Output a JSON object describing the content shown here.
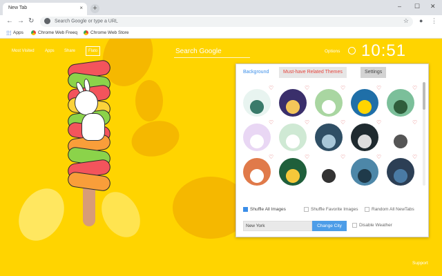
{
  "browser": {
    "tab_title": "New Tab",
    "tab_close": "×",
    "new_tab": "+",
    "window_controls": [
      "–",
      "☐",
      "✕"
    ],
    "omnibox_placeholder": "Search Google or type a URL",
    "bookmarks": [
      "Apps",
      "Chrome Web Freeq",
      "Chrome Web Store"
    ]
  },
  "topnav": {
    "items": [
      "Most Visited",
      "Apps",
      "Share",
      "Flato"
    ]
  },
  "search": {
    "placeholder": "Search Google"
  },
  "header": {
    "options": "Options",
    "time": "10:51"
  },
  "footer": {
    "support": "Support"
  },
  "panel": {
    "tabs": [
      "Background",
      "Must-have Related Themes",
      "Settings"
    ],
    "active_tab": "Background",
    "thumbnails": [
      {
        "bg": "#e8f4f0",
        "fg": "#3a7a6a"
      },
      {
        "bg": "#3a2f6b",
        "fg": "#f3c65a"
      },
      {
        "bg": "#a9d6a1",
        "fg": "#ffffff"
      },
      {
        "bg": "#1f6fa8",
        "fg": "#ffd400"
      },
      {
        "bg": "#7bbf9a",
        "fg": "#2f5d3b"
      },
      {
        "bg": "#e9d7f4",
        "fg": "#ffffff"
      },
      {
        "bg": "#cfe9d4",
        "fg": "#ffffff"
      },
      {
        "bg": "#2f4f65",
        "fg": "#a8c7d8"
      },
      {
        "bg": "#1f2a2f",
        "fg": "#dddddd"
      },
      {
        "bg": "#ffffff",
        "fg": "#555555"
      },
      {
        "bg": "#e07a4a",
        "fg": "#ffffff"
      },
      {
        "bg": "#1f5f3b",
        "fg": "#f6c83a"
      },
      {
        "bg": "#ffffff",
        "fg": "#333333"
      },
      {
        "bg": "#4d87a8",
        "fg": "#1f3a4a"
      },
      {
        "bg": "#2c3f55",
        "fg": "#4a7ba5"
      },
      {
        "bg": "#7fc44a",
        "fg": "#5a8a3a"
      },
      {
        "bg": "#f2e6c5",
        "fg": "#ffffff"
      },
      {
        "bg": "#d6ecd2",
        "fg": "#6a9d5e"
      },
      {
        "bg": "#f6e0a8",
        "fg": "#c79a3a"
      },
      {
        "bg": "#e7d9f0",
        "fg": "#8b6fa8"
      }
    ],
    "options": {
      "shuffle_all": "Shuffle All Images",
      "shuffle_favorite": "Shuffle Favorite Images",
      "random_newtabs": "Random All NewTabs"
    },
    "city_value": "New York",
    "change_city": "Change City",
    "disable_weather": "Disable Weather"
  }
}
